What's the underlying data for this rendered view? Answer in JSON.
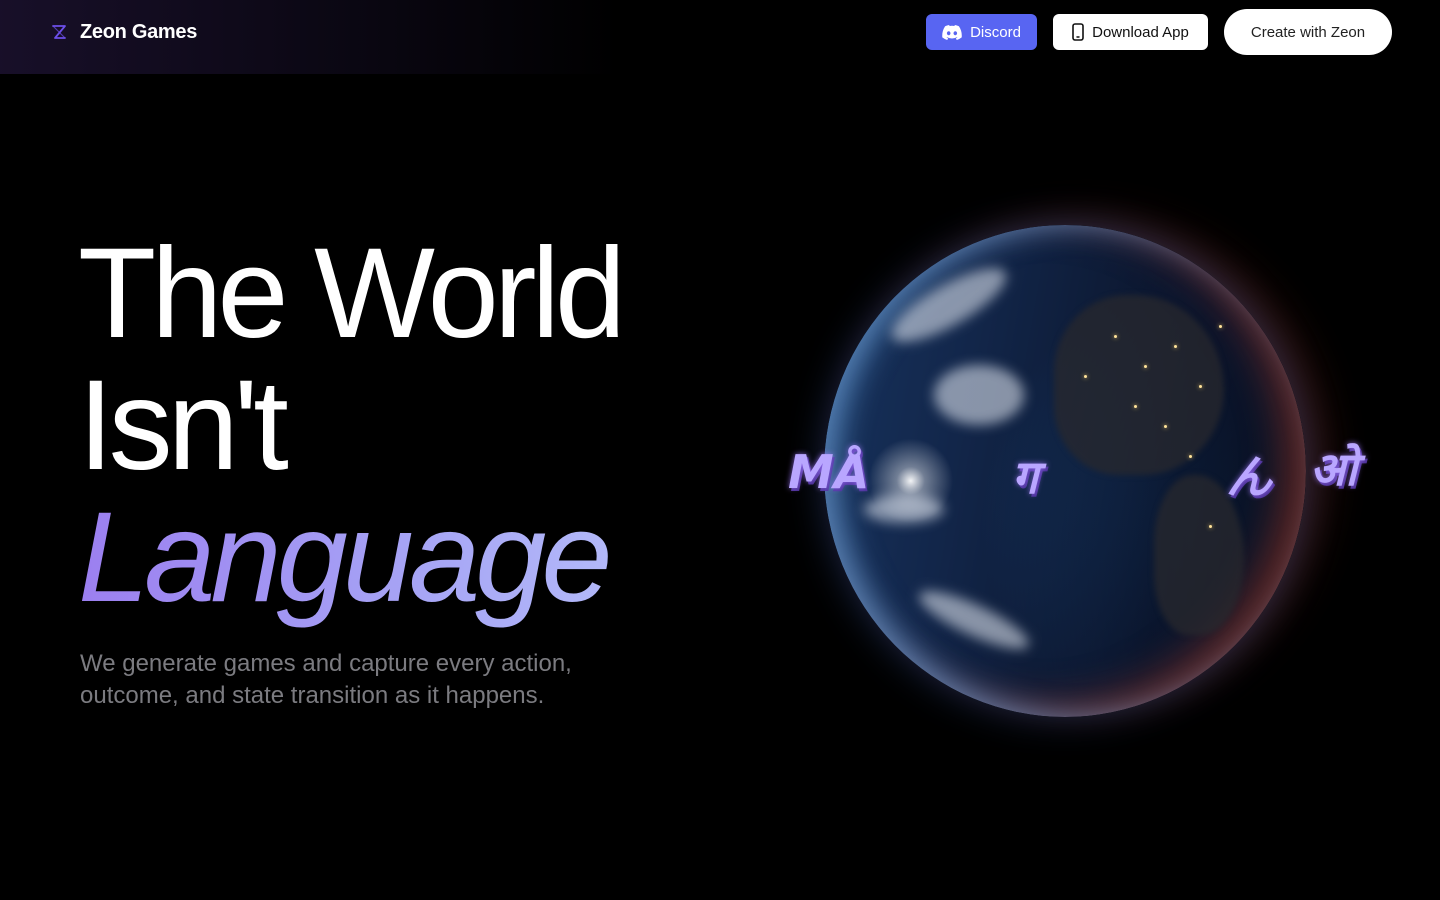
{
  "header": {
    "brand": {
      "name": "Zeon Games",
      "icon": "zeon-logo-icon"
    },
    "nav": {
      "discord_label": "Discord",
      "discord_icon": "discord-icon",
      "download_label": "Download App",
      "download_icon": "phone-icon",
      "create_label": "Create with Zeon"
    }
  },
  "hero": {
    "title_line_1": "The World",
    "title_line_2": "Isn't",
    "title_line_3": "Language",
    "subtitle": "We generate games and capture every action, outcome, and state transition as it happens."
  },
  "globe": {
    "glyphs": [
      "MÅ",
      "ग",
      "ん",
      "ओ"
    ]
  },
  "colors": {
    "background": "#000000",
    "discord": "#5865f2",
    "accent_gradient_start": "#9b7ff0",
    "accent_gradient_end": "#b9c3fb",
    "subtitle": "#7b7b80"
  }
}
